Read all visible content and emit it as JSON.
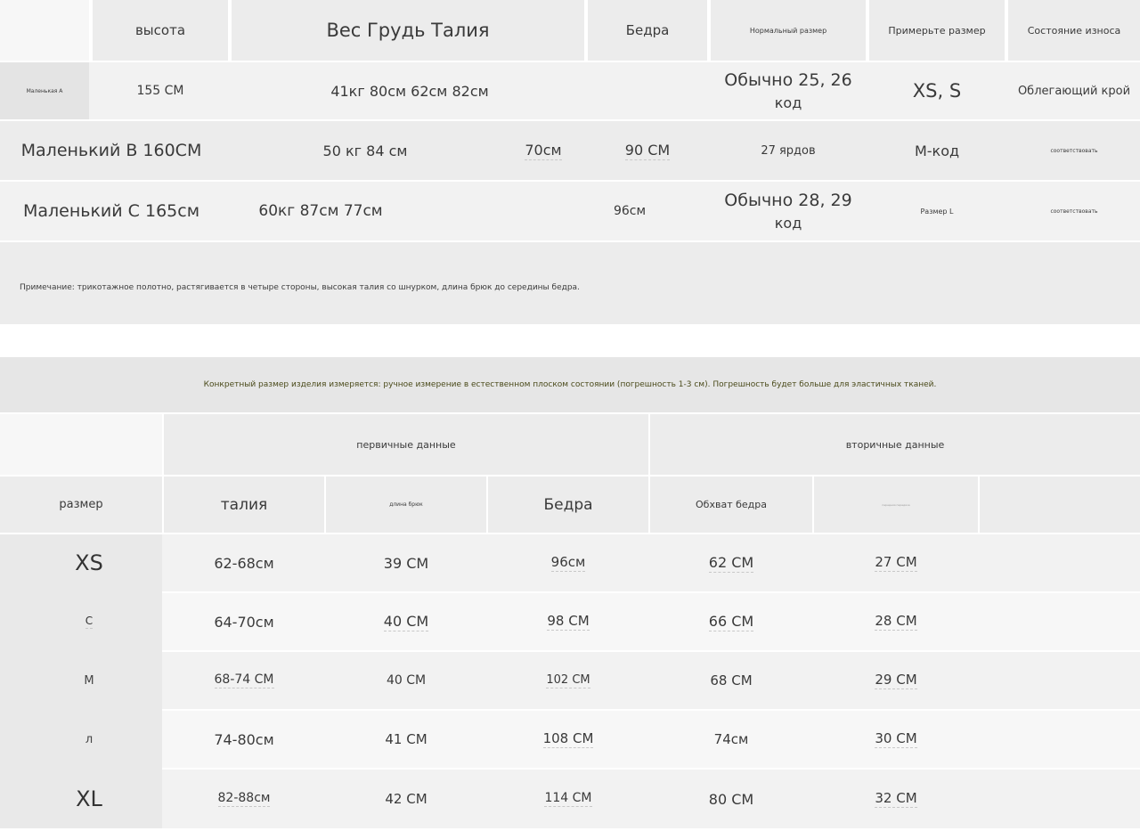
{
  "table1": {
    "header": {
      "height": "высота",
      "weight_chest_waist": "Вес Грудь Талия",
      "hips": "Бедра",
      "normal_size": "Нормальный размер",
      "try_size": "Примерьте размер",
      "wear_state": "Состояние износа"
    },
    "rows": [
      {
        "label": "Маленькая А",
        "height": "155 СМ",
        "measurements": "41кг 80см 62см 82см",
        "normal_line1": "Обычно 25, 26",
        "normal_line2": "код",
        "try": "XS, S",
        "wear": "Облегающий крой"
      },
      {
        "label": "Маленький В 160СМ",
        "measurements": "50 кг 84 см",
        "waist": "70см",
        "hips": "90 СМ",
        "normal": "27 ярдов",
        "try": "М-код",
        "wear": "соответствовать"
      },
      {
        "label": "Маленький С 165см",
        "measurements": "60кг 87см 77см",
        "hips": "96см",
        "normal_line1": "Обычно 28, 29",
        "normal_line2": "код",
        "try": "Размер L",
        "wear": "соответствовать"
      }
    ],
    "note": "Примечание: трикотажное полотно, растягивается в четыре стороны, высокая талия со шнурком, длина брюк до середины бедра."
  },
  "table2": {
    "title": "Конкретный размер изделия измеряется: ручное измерение в естественном плоском состоянии (погрешность 1-3 см). Погрешность будет больше для эластичных тканей.",
    "group_primary": "первичные данные",
    "group_secondary": "вторичные данные",
    "columns": [
      "размер",
      "талия",
      "длина брюк",
      "Бедра",
      "Обхват бедра",
      "передняя передача"
    ],
    "rows": [
      [
        "XS",
        "62-68см",
        "39 СМ",
        "96см",
        "62 СМ",
        "27 СМ"
      ],
      [
        "С",
        "64-70см",
        "40 СМ",
        "98 СМ",
        "66 СМ",
        "28 СМ"
      ],
      [
        "М",
        "68-74 СМ",
        "40 СМ",
        "102 СМ",
        "68 СМ",
        "29 СМ"
      ],
      [
        "л",
        "74-80см",
        "41 СМ",
        "108 СМ",
        "74см",
        "30 СМ"
      ],
      [
        "XL",
        "82-88см",
        "42 СМ",
        "114 СМ",
        "80 СМ",
        "32 СМ"
      ]
    ]
  }
}
